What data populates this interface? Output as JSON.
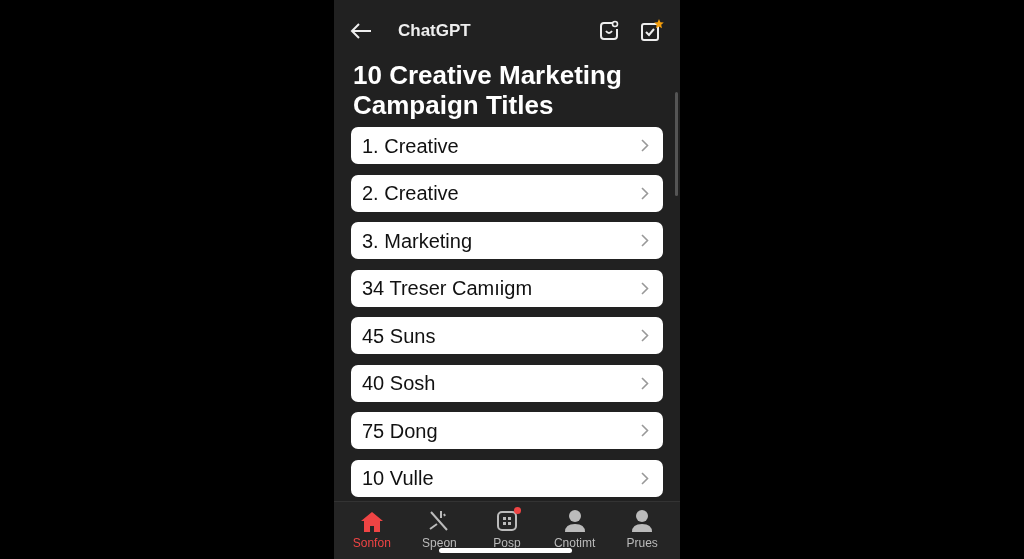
{
  "header": {
    "title": "ChatGPT"
  },
  "heading": "10 Creative Marketing Campaign Titles",
  "items": [
    {
      "label": "1. Creative"
    },
    {
      "label": "2. Creative"
    },
    {
      "label": "3. Marketing"
    },
    {
      "label": "34 Treser Camıigm"
    },
    {
      "label": "45 Suns"
    },
    {
      "label": "40 Sosh"
    },
    {
      "label": "75 Dong"
    },
    {
      "label": "10 Vulle"
    }
  ],
  "tabs": [
    {
      "label": "Sonfon",
      "kind": "home",
      "selected": true,
      "badge": false
    },
    {
      "label": "Speon",
      "kind": "spark",
      "selected": false,
      "badge": false
    },
    {
      "label": "Posp",
      "kind": "grid",
      "selected": false,
      "badge": true
    },
    {
      "label": "Cnotimt",
      "kind": "person",
      "selected": false,
      "badge": false
    },
    {
      "label": "Prues",
      "kind": "person",
      "selected": false,
      "badge": false
    }
  ]
}
